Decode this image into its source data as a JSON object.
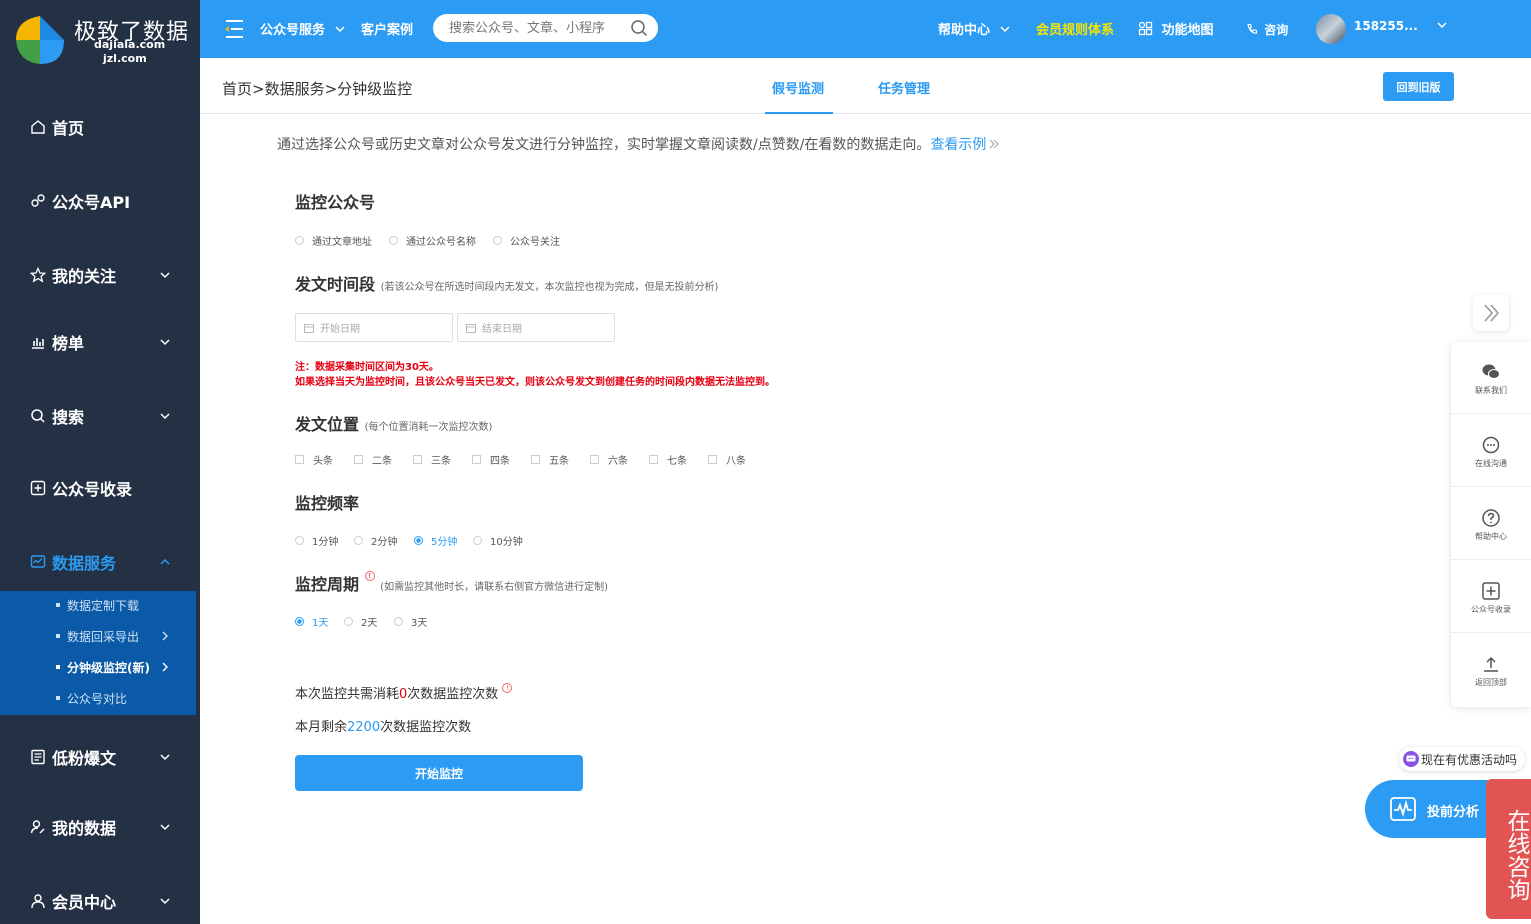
{
  "brand": {
    "title": "极致了数据",
    "domain1": "dajiala.com",
    "domain2": "jzl.com"
  },
  "sidebar": {
    "items": [
      {
        "label": "首页",
        "icon": "home-icon"
      },
      {
        "label": "公众号API",
        "icon": "api-icon"
      },
      {
        "label": "我的关注",
        "icon": "star-icon"
      },
      {
        "label": "榜单",
        "icon": "bar-chart-icon"
      },
      {
        "label": "搜索",
        "icon": "search-icon"
      },
      {
        "label": "公众号收录",
        "icon": "plus-square-icon"
      },
      {
        "label": "数据服务",
        "icon": "monitor-icon"
      },
      {
        "label": "低粉爆文",
        "icon": "document-icon"
      },
      {
        "label": "我的数据",
        "icon": "user-data-icon"
      },
      {
        "label": "会员中心",
        "icon": "user-icon"
      }
    ],
    "sub_items": [
      {
        "label": "数据定制下载"
      },
      {
        "label": "数据回采导出"
      },
      {
        "label": "分钟级监控(新)"
      },
      {
        "label": "公众号对比"
      }
    ]
  },
  "topbar": {
    "service": "公众号服务",
    "cases": "客户案例",
    "search_placeholder": "搜索公众号、文章、小程序",
    "help": "帮助中心",
    "member_rules": "会员规则体系",
    "feature_map": "功能地图",
    "consult": "咨询",
    "user_name": "158255..."
  },
  "subheader": {
    "breadcrumb": "首页>数据服务>分钟级监控",
    "tabs": [
      "假号监测",
      "任务管理"
    ],
    "old_version": "回到旧版"
  },
  "intro": {
    "text": "通过选择公众号或历史文章对公众号发文进行分钟监控，实时掌握文章阅读数/点赞数/在看数的数据走向。",
    "link": "查看示例"
  },
  "sections": {
    "account": {
      "title": "监控公众号",
      "options": [
        "通过文章地址",
        "通过公众号名称",
        "公众号关注"
      ]
    },
    "time": {
      "title": "发文时间段",
      "hint": "(若该公众号在所选时间段内无发文，本次监控也视为完成，但是无投前分析)",
      "start_placeholder": "开始日期",
      "end_placeholder": "结束日期"
    },
    "notes": [
      "注：数据采集时间区间为30天。",
      "如果选择当天为监控时间，且该公众号当天已发文，则该公众号发文到创建任务的时间段内数据无法监控到。"
    ],
    "position": {
      "title": "发文位置",
      "hint": "(每个位置消耗一次监控次数)",
      "options": [
        "头条",
        "二条",
        "三条",
        "四条",
        "五条",
        "六条",
        "七条",
        "八条"
      ]
    },
    "frequency": {
      "title": "监控频率",
      "options": [
        "1分钟",
        "2分钟",
        "5分钟",
        "10分钟"
      ],
      "selected": "5分钟"
    },
    "period": {
      "title": "监控周期",
      "hint": "(如需监控其他时长，请联系右侧官方微信进行定制)",
      "options": [
        "1天",
        "2天",
        "3天"
      ],
      "selected": "1天"
    }
  },
  "usage": {
    "consume_prefix": "本次监控共需消耗",
    "consume_value": "0",
    "consume_suffix": "次数据监控次数",
    "remain_prefix": "本月剩余",
    "remain_value": "2200",
    "remain_suffix": "次数据监控次数"
  },
  "start_button": "开始监控",
  "right_panel": {
    "items": [
      {
        "label": "联系我们",
        "icon": "wechat-icon"
      },
      {
        "label": "在线沟通",
        "icon": "chat-icon"
      },
      {
        "label": "帮助中心",
        "icon": "help-icon"
      },
      {
        "label": "公众号收录",
        "icon": "plus-square-icon"
      },
      {
        "label": "返回顶部",
        "icon": "upload-icon"
      }
    ]
  },
  "promo": "现在有优惠活动吗",
  "analysis": "投前分析",
  "consult_tab": "在线咨询",
  "colors": {
    "primary": "#2b9bf4",
    "sidebar_bg": "#243043",
    "sub_bg": "#0a5aa8",
    "member_rules": "#f7e600",
    "warning": "#e60012",
    "consult": "#e25454"
  }
}
